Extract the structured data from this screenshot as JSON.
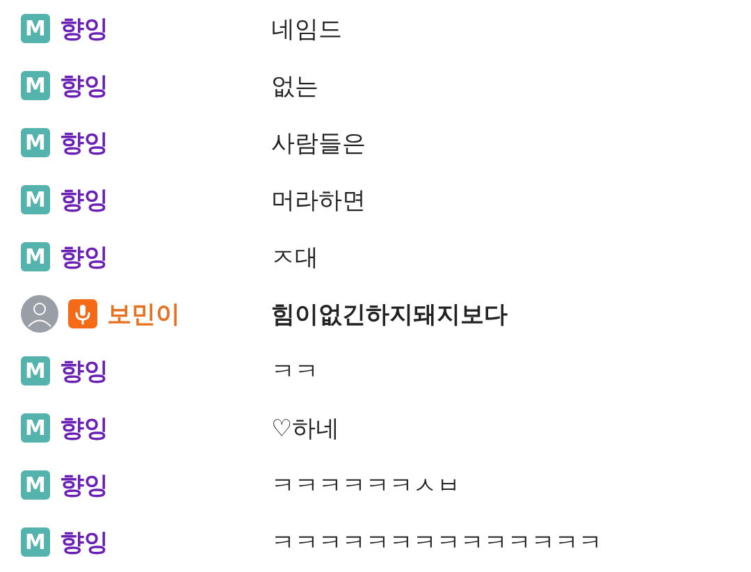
{
  "messages": [
    {
      "kind": "manager",
      "badge": "M",
      "name": "향잉",
      "text": "네임드"
    },
    {
      "kind": "manager",
      "badge": "M",
      "name": "향잉",
      "text": "없는"
    },
    {
      "kind": "manager",
      "badge": "M",
      "name": "향잉",
      "text": "사람들은"
    },
    {
      "kind": "manager",
      "badge": "M",
      "name": "향잉",
      "text": "머라하면"
    },
    {
      "kind": "manager",
      "badge": "M",
      "name": "향잉",
      "text": "ㅈ대"
    },
    {
      "kind": "streamer",
      "name": "보민이",
      "text": "힘이없긴하지돼지보다"
    },
    {
      "kind": "manager",
      "badge": "M",
      "name": "향잉",
      "text": "ㅋㅋ"
    },
    {
      "kind": "manager",
      "badge": "M",
      "name": "향잉",
      "text": "♡하네"
    },
    {
      "kind": "manager",
      "badge": "M",
      "name": "향잉",
      "text": "ㅋㅋㅋㅋㅋㅋㅅㅂ"
    },
    {
      "kind": "manager",
      "badge": "M",
      "name": "향잉",
      "text": "ㅋㅋㅋㅋㅋㅋㅋㅋㅋㅋㅋㅋㅋㅋ"
    }
  ]
}
